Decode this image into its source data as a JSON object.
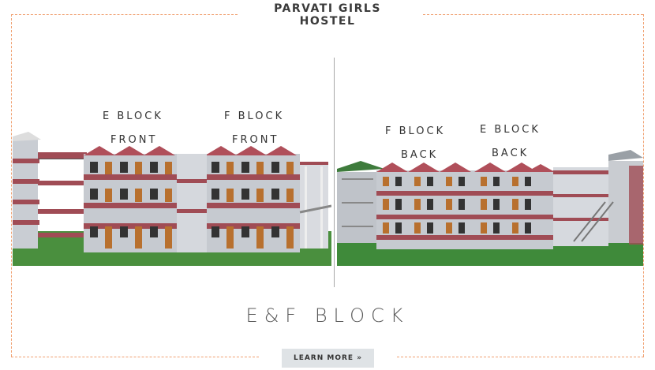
{
  "title": {
    "line1": "PARVATI GIRLS",
    "line2": "HOSTEL"
  },
  "left_render": {
    "labels": [
      {
        "text": "E BLOCK"
      },
      {
        "text": "FRONT"
      },
      {
        "text": "F BLOCK"
      },
      {
        "text": "FRONT"
      }
    ]
  },
  "right_render": {
    "labels": [
      {
        "text": "F BLOCK"
      },
      {
        "text": "BACK"
      },
      {
        "text": "E BLOCK"
      },
      {
        "text": "BACK"
      }
    ]
  },
  "block_name": "E&F BLOCK",
  "cta": {
    "label": "LEARN MORE »"
  },
  "colors": {
    "frame": "#f0a070",
    "roof": "#b45a5a",
    "wall": "#c8ccd2",
    "grass": "#3f8a3a",
    "door": "#b8702e"
  }
}
